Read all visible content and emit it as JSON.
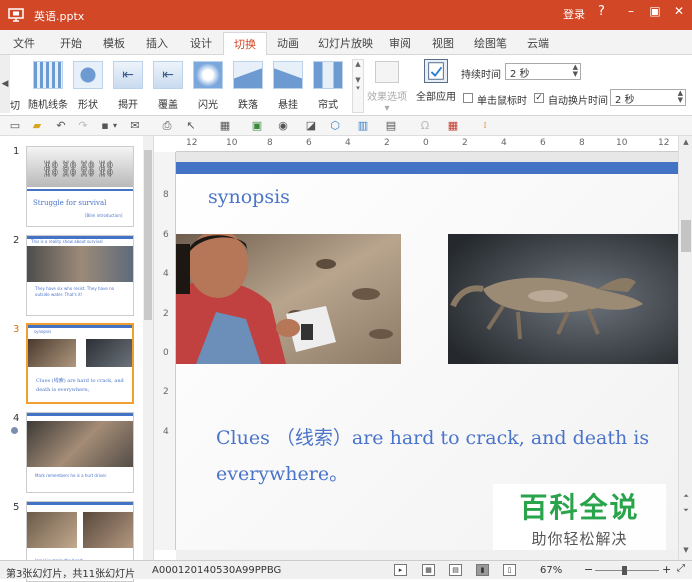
{
  "window": {
    "title": "英语.pptx",
    "login_label": "登录",
    "help_label": "?",
    "minimize_label": "–",
    "restore_label": "▣",
    "close_label": "✕"
  },
  "tabs": [
    "文件",
    "开始",
    "模板",
    "插入",
    "设计",
    "切换",
    "动画",
    "幻灯片放映",
    "审阅",
    "视图",
    "绘图笔",
    "云端"
  ],
  "active_tab": "切换",
  "ribbon": {
    "cut_label": "切",
    "effects": [
      "随机线条",
      "形状",
      "揭开",
      "覆盖",
      "闪光",
      "跌落",
      "悬挂",
      "帘式"
    ],
    "effect_options_label": "效果选项",
    "apply_all_label": "全部应用",
    "duration_label": "持续时间",
    "duration_value": "2 秒",
    "on_click_label": "单击鼠标时",
    "on_click_checked": false,
    "auto_advance_label": "自动换片时间",
    "auto_advance_checked": true,
    "auto_advance_value": "2 秒"
  },
  "thumbnails": [
    {
      "number": "1",
      "title": "Struggle for survival",
      "subtitle": "[Bilm introduction]"
    },
    {
      "number": "2",
      "title": "This is a reality show about survival",
      "text": "They have six who resist. They have no outside water. That's it!"
    },
    {
      "number": "3",
      "title": "synopsis",
      "text": "Clues (线索) are hard to crack, and death is everywhere。"
    },
    {
      "number": "4",
      "text": "Mark remembers he is a hurt driver."
    },
    {
      "number": "5",
      "text": "Israel in make the heart"
    }
  ],
  "selected_slide": "3",
  "rulers": {
    "horizontal": [
      "12",
      "10",
      "8",
      "6",
      "4",
      "2",
      "0",
      "2",
      "4",
      "6",
      "8",
      "10",
      "12"
    ],
    "vertical": [
      "8",
      "6",
      "4",
      "2",
      "0",
      "2",
      "4"
    ]
  },
  "slide": {
    "heading": "synopsis",
    "body": "Clues （线索）are hard to crack, and death is everywhere。"
  },
  "status": {
    "slide_info": "第3张幻灯片，共11张幻灯片",
    "code": "A000120140530A99PPBG",
    "zoom": "67%",
    "zoom_fraction": 0.45
  },
  "watermark": {
    "title": "百科全说",
    "subtitle": "助你轻松解决"
  },
  "colors": {
    "accent": "#d24726",
    "slide_text": "#4a74c9",
    "slide_bar": "#4472c4",
    "selection": "#f0a030",
    "watermark": "#2aa44a"
  }
}
